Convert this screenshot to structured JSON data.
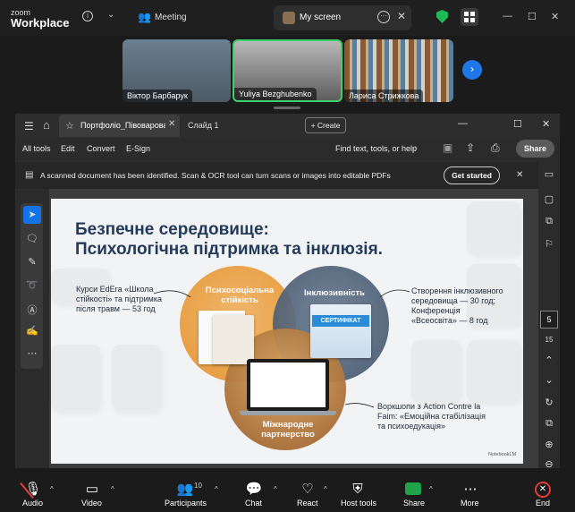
{
  "zoom": {
    "logo_line1": "zoom",
    "logo_line2": "Workplace",
    "meeting_label": "Meeting",
    "my_screen_label": "My screen",
    "participants": [
      {
        "name": "Віктор Барбарук"
      },
      {
        "name": "Yuliya Bezghubenko"
      },
      {
        "name": "Лариса Стрижкова"
      }
    ],
    "participant_count": "10",
    "bottom": {
      "audio": "Audio",
      "video": "Video",
      "participants": "Participants",
      "chat": "Chat",
      "react": "React",
      "host_tools": "Host tools",
      "share": "Share",
      "more": "More",
      "end": "End"
    }
  },
  "acrobat": {
    "tab_doc": "Портфоліо_Півоварова...",
    "tab_slide": "Слайд 1",
    "create": "Create",
    "menu": [
      "All tools",
      "Edit",
      "Convert",
      "E-Sign"
    ],
    "find": "Find text, tools, or help",
    "share": "Share",
    "banner_text": "A scanned document has been identified. Scan & OCR tool can turn scans or images into editable PDFs",
    "get_started": "Get started",
    "page_current": "5",
    "page_total": "15"
  },
  "slide": {
    "title_line1": "Безпечне середовище:",
    "title_line2": "Психологічна підтримка та інклюзія.",
    "circle_orange_line1": "Психосоціальна",
    "circle_orange_line2": "стійкість",
    "circle_blue": "Інклюзивність",
    "circle_brown_line1": "Міжнародне",
    "circle_brown_line2": "партнерство",
    "cert_label": "СЕРТИФІКАТ",
    "left_callout": [
      "Курси EdEra «Школа",
      "стійкості» та підтримка",
      "після травм — 53 год"
    ],
    "right_callout": [
      "Створення інклюзивного",
      "середовища — 30 год;",
      "Конференція",
      "«Всеосвіта» — 8 год"
    ],
    "bottom_callout": [
      "Воркшопи з Action Contre la",
      "Faim: «Емоційна стабілізація",
      "та психоедукація»"
    ],
    "notebooklm": "NotebookLM"
  }
}
